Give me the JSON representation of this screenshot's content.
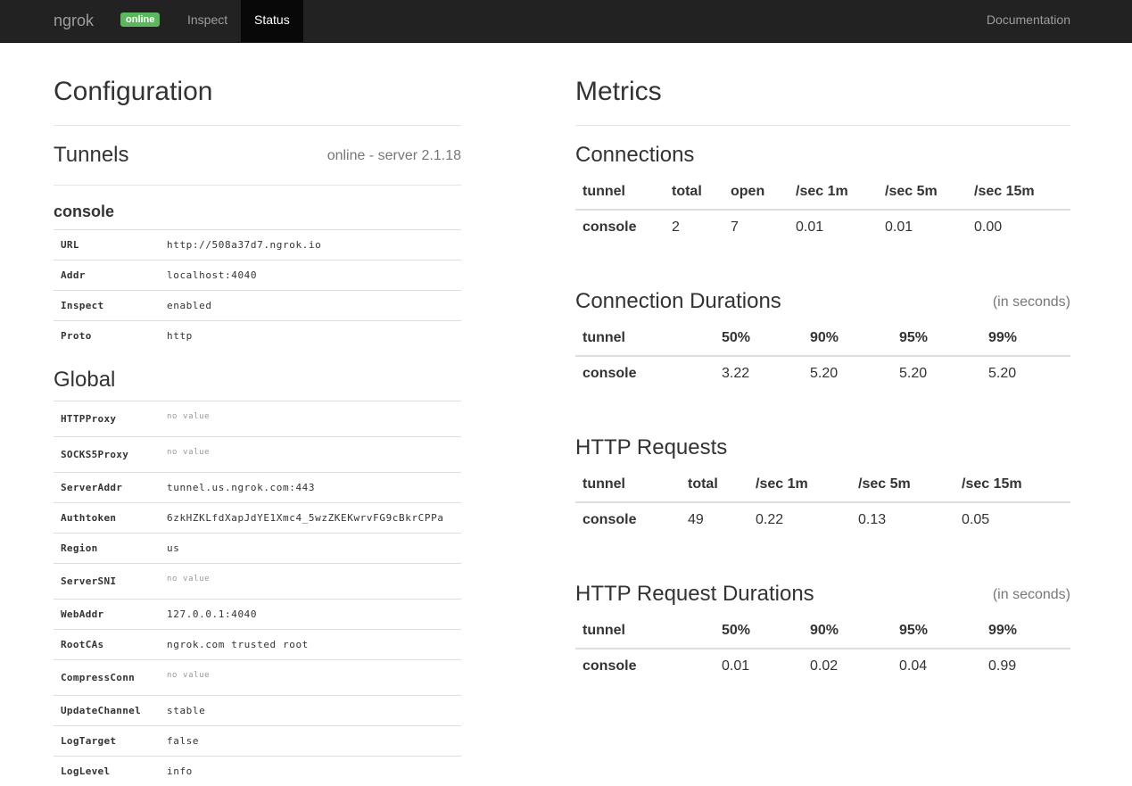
{
  "nav": {
    "brand": "ngrok",
    "status_badge": "online",
    "inspect": "Inspect",
    "status": "Status",
    "documentation": "Documentation",
    "badge_color": "#5cb85c"
  },
  "config": {
    "title": "Configuration",
    "tunnels_title": "Tunnels",
    "tunnels_status": "online - server 2.1.18",
    "tunnel_name": "console",
    "tunnel_rows": [
      {
        "key": "URL",
        "value": "http://508a37d7.ngrok.io"
      },
      {
        "key": "Addr",
        "value": "localhost:4040"
      },
      {
        "key": "Inspect",
        "value": "enabled"
      },
      {
        "key": "Proto",
        "value": "http"
      }
    ],
    "global_title": "Global",
    "global_rows": [
      {
        "key": "HTTPProxy",
        "value": "no value"
      },
      {
        "key": "SOCKS5Proxy",
        "value": "no value"
      },
      {
        "key": "ServerAddr",
        "value": "tunnel.us.ngrok.com:443"
      },
      {
        "key": "Authtoken",
        "value": "6zkHZKLfdXapJdYE1Xmc4_5wzZKEKwrvFG9cBkrCPPa"
      },
      {
        "key": "Region",
        "value": "us"
      },
      {
        "key": "ServerSNI",
        "value": "no value"
      },
      {
        "key": "WebAddr",
        "value": "127.0.0.1:4040"
      },
      {
        "key": "RootCAs",
        "value": "ngrok.com trusted root"
      },
      {
        "key": "CompressConn",
        "value": "no value"
      },
      {
        "key": "UpdateChannel",
        "value": "stable"
      },
      {
        "key": "LogTarget",
        "value": "false"
      },
      {
        "key": "LogLevel",
        "value": "info"
      }
    ]
  },
  "metrics": {
    "title": "Metrics",
    "connections": {
      "title": "Connections",
      "headers": [
        "tunnel",
        "total",
        "open",
        "/sec 1m",
        "/sec 5m",
        "/sec 15m"
      ],
      "row": [
        "console",
        "2",
        "7",
        "0.01",
        "0.01",
        "0.00"
      ]
    },
    "connection_durations": {
      "title": "Connection Durations",
      "note": "(in seconds)",
      "headers": [
        "tunnel",
        "50%",
        "90%",
        "95%",
        "99%"
      ],
      "row": [
        "console",
        "3.22",
        "5.20",
        "5.20",
        "5.20"
      ]
    },
    "http_requests": {
      "title": "HTTP Requests",
      "headers": [
        "tunnel",
        "total",
        "/sec 1m",
        "/sec 5m",
        "/sec 15m"
      ],
      "row": [
        "console",
        "49",
        "0.22",
        "0.13",
        "0.05"
      ]
    },
    "http_request_durations": {
      "title": "HTTP Request Durations",
      "note": "(in seconds)",
      "headers": [
        "tunnel",
        "50%",
        "90%",
        "95%",
        "99%"
      ],
      "row": [
        "console",
        "0.01",
        "0.02",
        "0.04",
        "0.99"
      ]
    }
  }
}
